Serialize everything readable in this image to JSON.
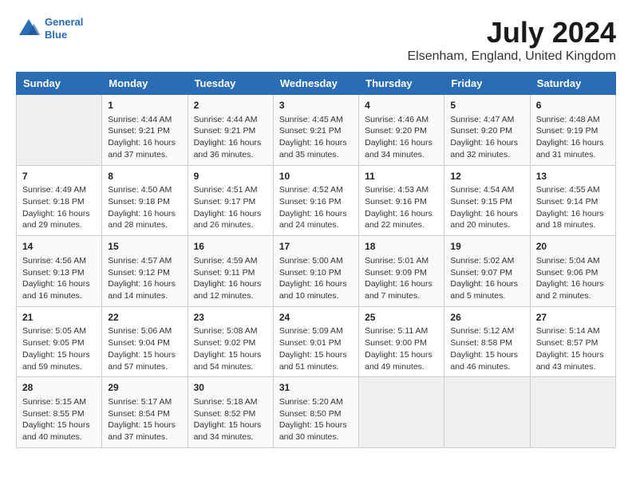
{
  "logo": {
    "line1": "General",
    "line2": "Blue"
  },
  "title": "July 2024",
  "subtitle": "Elsenham, England, United Kingdom",
  "days_of_week": [
    "Sunday",
    "Monday",
    "Tuesday",
    "Wednesday",
    "Thursday",
    "Friday",
    "Saturday"
  ],
  "weeks": [
    [
      {
        "day": "",
        "content": ""
      },
      {
        "day": "1",
        "content": "Sunrise: 4:44 AM\nSunset: 9:21 PM\nDaylight: 16 hours\nand 37 minutes."
      },
      {
        "day": "2",
        "content": "Sunrise: 4:44 AM\nSunset: 9:21 PM\nDaylight: 16 hours\nand 36 minutes."
      },
      {
        "day": "3",
        "content": "Sunrise: 4:45 AM\nSunset: 9:21 PM\nDaylight: 16 hours\nand 35 minutes."
      },
      {
        "day": "4",
        "content": "Sunrise: 4:46 AM\nSunset: 9:20 PM\nDaylight: 16 hours\nand 34 minutes."
      },
      {
        "day": "5",
        "content": "Sunrise: 4:47 AM\nSunset: 9:20 PM\nDaylight: 16 hours\nand 32 minutes."
      },
      {
        "day": "6",
        "content": "Sunrise: 4:48 AM\nSunset: 9:19 PM\nDaylight: 16 hours\nand 31 minutes."
      }
    ],
    [
      {
        "day": "7",
        "content": "Sunrise: 4:49 AM\nSunset: 9:18 PM\nDaylight: 16 hours\nand 29 minutes."
      },
      {
        "day": "8",
        "content": "Sunrise: 4:50 AM\nSunset: 9:18 PM\nDaylight: 16 hours\nand 28 minutes."
      },
      {
        "day": "9",
        "content": "Sunrise: 4:51 AM\nSunset: 9:17 PM\nDaylight: 16 hours\nand 26 minutes."
      },
      {
        "day": "10",
        "content": "Sunrise: 4:52 AM\nSunset: 9:16 PM\nDaylight: 16 hours\nand 24 minutes."
      },
      {
        "day": "11",
        "content": "Sunrise: 4:53 AM\nSunset: 9:16 PM\nDaylight: 16 hours\nand 22 minutes."
      },
      {
        "day": "12",
        "content": "Sunrise: 4:54 AM\nSunset: 9:15 PM\nDaylight: 16 hours\nand 20 minutes."
      },
      {
        "day": "13",
        "content": "Sunrise: 4:55 AM\nSunset: 9:14 PM\nDaylight: 16 hours\nand 18 minutes."
      }
    ],
    [
      {
        "day": "14",
        "content": "Sunrise: 4:56 AM\nSunset: 9:13 PM\nDaylight: 16 hours\nand 16 minutes."
      },
      {
        "day": "15",
        "content": "Sunrise: 4:57 AM\nSunset: 9:12 PM\nDaylight: 16 hours\nand 14 minutes."
      },
      {
        "day": "16",
        "content": "Sunrise: 4:59 AM\nSunset: 9:11 PM\nDaylight: 16 hours\nand 12 minutes."
      },
      {
        "day": "17",
        "content": "Sunrise: 5:00 AM\nSunset: 9:10 PM\nDaylight: 16 hours\nand 10 minutes."
      },
      {
        "day": "18",
        "content": "Sunrise: 5:01 AM\nSunset: 9:09 PM\nDaylight: 16 hours\nand 7 minutes."
      },
      {
        "day": "19",
        "content": "Sunrise: 5:02 AM\nSunset: 9:07 PM\nDaylight: 16 hours\nand 5 minutes."
      },
      {
        "day": "20",
        "content": "Sunrise: 5:04 AM\nSunset: 9:06 PM\nDaylight: 16 hours\nand 2 minutes."
      }
    ],
    [
      {
        "day": "21",
        "content": "Sunrise: 5:05 AM\nSunset: 9:05 PM\nDaylight: 15 hours\nand 59 minutes."
      },
      {
        "day": "22",
        "content": "Sunrise: 5:06 AM\nSunset: 9:04 PM\nDaylight: 15 hours\nand 57 minutes."
      },
      {
        "day": "23",
        "content": "Sunrise: 5:08 AM\nSunset: 9:02 PM\nDaylight: 15 hours\nand 54 minutes."
      },
      {
        "day": "24",
        "content": "Sunrise: 5:09 AM\nSunset: 9:01 PM\nDaylight: 15 hours\nand 51 minutes."
      },
      {
        "day": "25",
        "content": "Sunrise: 5:11 AM\nSunset: 9:00 PM\nDaylight: 15 hours\nand 49 minutes."
      },
      {
        "day": "26",
        "content": "Sunrise: 5:12 AM\nSunset: 8:58 PM\nDaylight: 15 hours\nand 46 minutes."
      },
      {
        "day": "27",
        "content": "Sunrise: 5:14 AM\nSunset: 8:57 PM\nDaylight: 15 hours\nand 43 minutes."
      }
    ],
    [
      {
        "day": "28",
        "content": "Sunrise: 5:15 AM\nSunset: 8:55 PM\nDaylight: 15 hours\nand 40 minutes."
      },
      {
        "day": "29",
        "content": "Sunrise: 5:17 AM\nSunset: 8:54 PM\nDaylight: 15 hours\nand 37 minutes."
      },
      {
        "day": "30",
        "content": "Sunrise: 5:18 AM\nSunset: 8:52 PM\nDaylight: 15 hours\nand 34 minutes."
      },
      {
        "day": "31",
        "content": "Sunrise: 5:20 AM\nSunset: 8:50 PM\nDaylight: 15 hours\nand 30 minutes."
      },
      {
        "day": "",
        "content": ""
      },
      {
        "day": "",
        "content": ""
      },
      {
        "day": "",
        "content": ""
      }
    ]
  ]
}
